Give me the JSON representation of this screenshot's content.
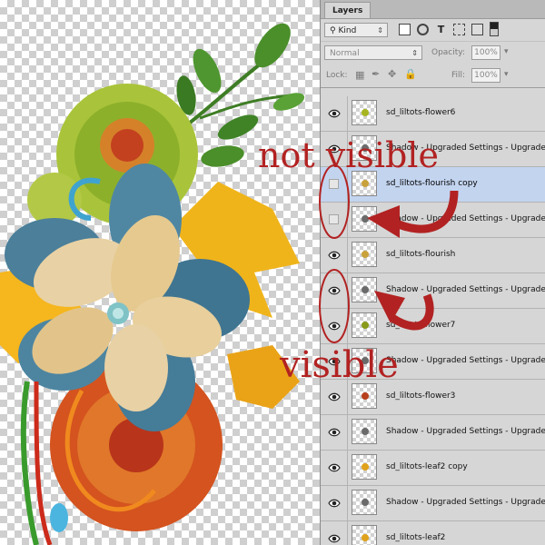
{
  "panel": {
    "tab_label": "Layers",
    "filter": {
      "kind_value": "Kind"
    },
    "blend": {
      "mode_value": "Normal",
      "opacity_label": "Opacity:",
      "opacity_value": "100%"
    },
    "lock": {
      "lock_label": "Lock:",
      "fill_label": "Fill:",
      "fill_value": "100%"
    },
    "layers": [
      {
        "name": "sd_liltots-flower6",
        "visible": true,
        "selected": false,
        "thumb": "#a7b520"
      },
      {
        "name": "Shadow - Upgraded Settings - Upgrade",
        "visible": true,
        "selected": false,
        "thumb": "#6a6a6a"
      },
      {
        "name": "sd_liltots-flourish copy",
        "visible": false,
        "selected": true,
        "thumb": "#c9a23b"
      },
      {
        "name": "Shadow - Upgraded Settings - Upgrade",
        "visible": false,
        "selected": false,
        "thumb": "#6a6a6a"
      },
      {
        "name": "sd_liltots-flourish",
        "visible": true,
        "selected": false,
        "thumb": "#c9a23b"
      },
      {
        "name": "Shadow - Upgraded Settings - Upgrade",
        "visible": true,
        "selected": false,
        "thumb": "#6a6a6a"
      },
      {
        "name": "sd_liltots-flower7",
        "visible": true,
        "selected": false,
        "thumb": "#8a9a1a"
      },
      {
        "name": "Shadow - Upgraded Settings - Upgrade",
        "visible": true,
        "selected": false,
        "thumb": "#6a6a6a"
      },
      {
        "name": "sd_liltots-flower3",
        "visible": true,
        "selected": false,
        "thumb": "#b8401d"
      },
      {
        "name": "Shadow - Upgraded Settings - Upgrade",
        "visible": true,
        "selected": false,
        "thumb": "#6a6a6a"
      },
      {
        "name": "sd_liltots-leaf2 copy",
        "visible": true,
        "selected": false,
        "thumb": "#e0a21c"
      },
      {
        "name": "Shadow - Upgraded Settings - Upgrade",
        "visible": true,
        "selected": false,
        "thumb": "#6a6a6a"
      },
      {
        "name": "sd_liltots-leaf2",
        "visible": true,
        "selected": false,
        "thumb": "#e0a21c"
      }
    ]
  },
  "annotations": {
    "not_visible": "not visible",
    "visible": "visible",
    "color": "#b22222"
  }
}
